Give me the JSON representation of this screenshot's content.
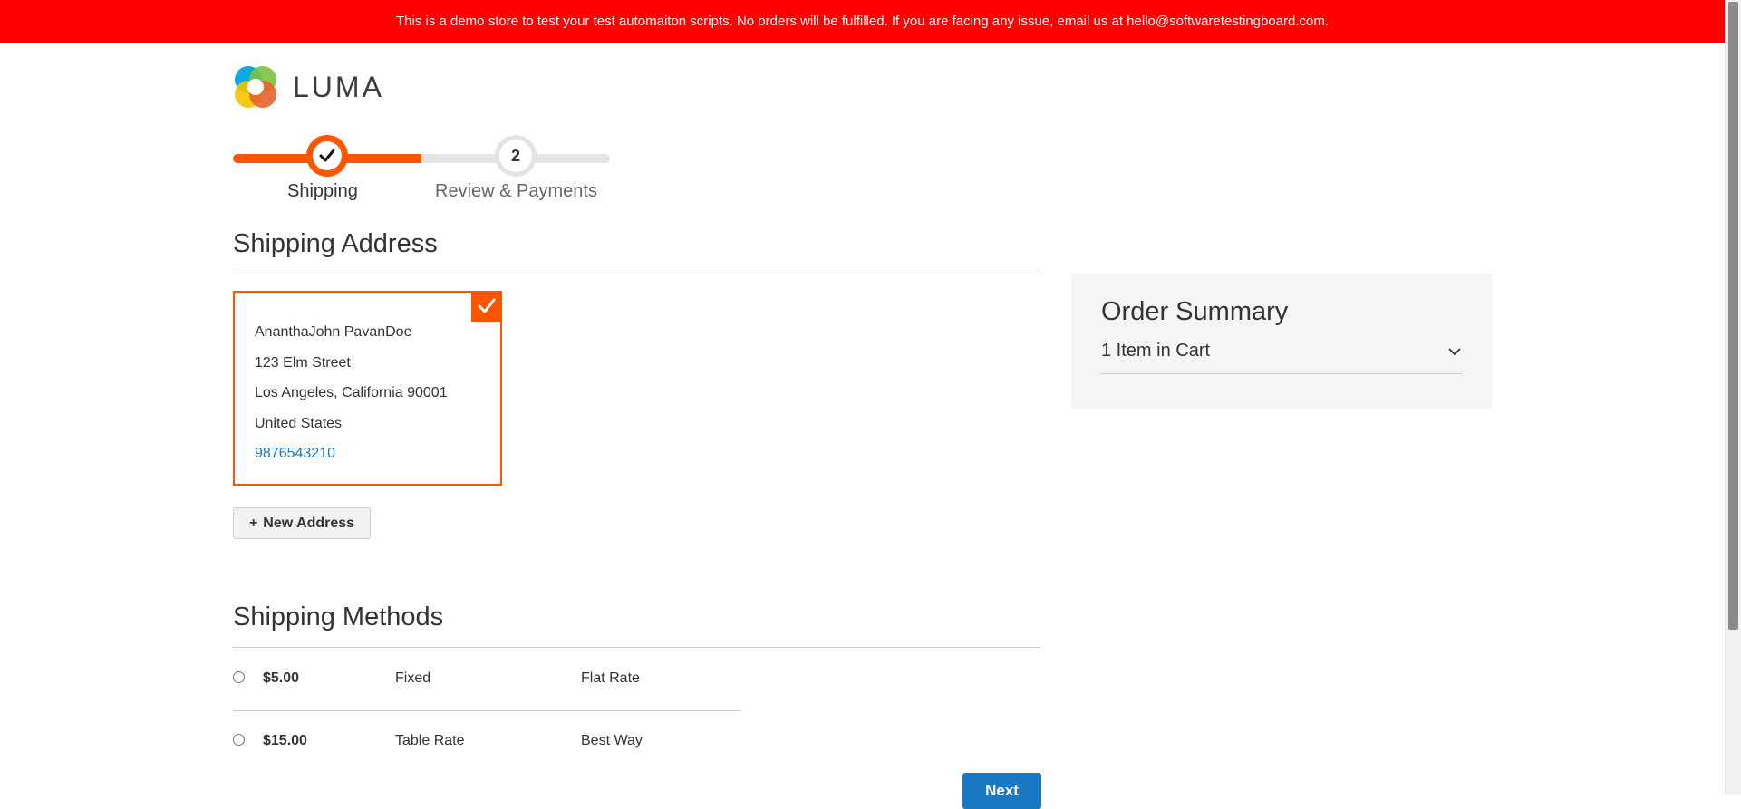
{
  "banner": {
    "text": "This is a demo store to test your test automaiton scripts. No orders will be fulfilled. If you are facing any issue, email us at hello@softwaretestingboard.com."
  },
  "logo": {
    "text": "LUMA",
    "icon": "luma-logo-icon",
    "colors": [
      "#00b0e0",
      "#8dc63f",
      "#f26322",
      "#ffc20e"
    ]
  },
  "progress": {
    "steps": [
      {
        "number": "1",
        "label": "Shipping",
        "state": "complete"
      },
      {
        "number": "2",
        "label": "Review & Payments",
        "state": "pending"
      }
    ],
    "accent": "#ff5501"
  },
  "shipping_address": {
    "title": "Shipping Address",
    "selected_card": {
      "name": "AnanthaJohn PavanDoe",
      "street": "123 Elm Street",
      "city_line": "Los Angeles, California 90001",
      "country": "United States",
      "phone": "9876543210",
      "selected_icon": "checkmark-icon"
    },
    "new_address_label": "New Address",
    "new_address_icon": "plus-icon"
  },
  "shipping_methods": {
    "title": "Shipping Methods",
    "rows": [
      {
        "price": "$5.00",
        "method": "Fixed",
        "carrier": "Flat Rate"
      },
      {
        "price": "$15.00",
        "method": "Table Rate",
        "carrier": "Best Way"
      }
    ],
    "next_label": "Next"
  },
  "order_summary": {
    "title": "Order Summary",
    "items_label": "1 Item in Cart",
    "toggle_icon": "chevron-down-icon"
  },
  "colors": {
    "banner": "#ff0000",
    "accent": "#ff5501",
    "link": "#1979c3",
    "primary_button": "#1979c3"
  }
}
